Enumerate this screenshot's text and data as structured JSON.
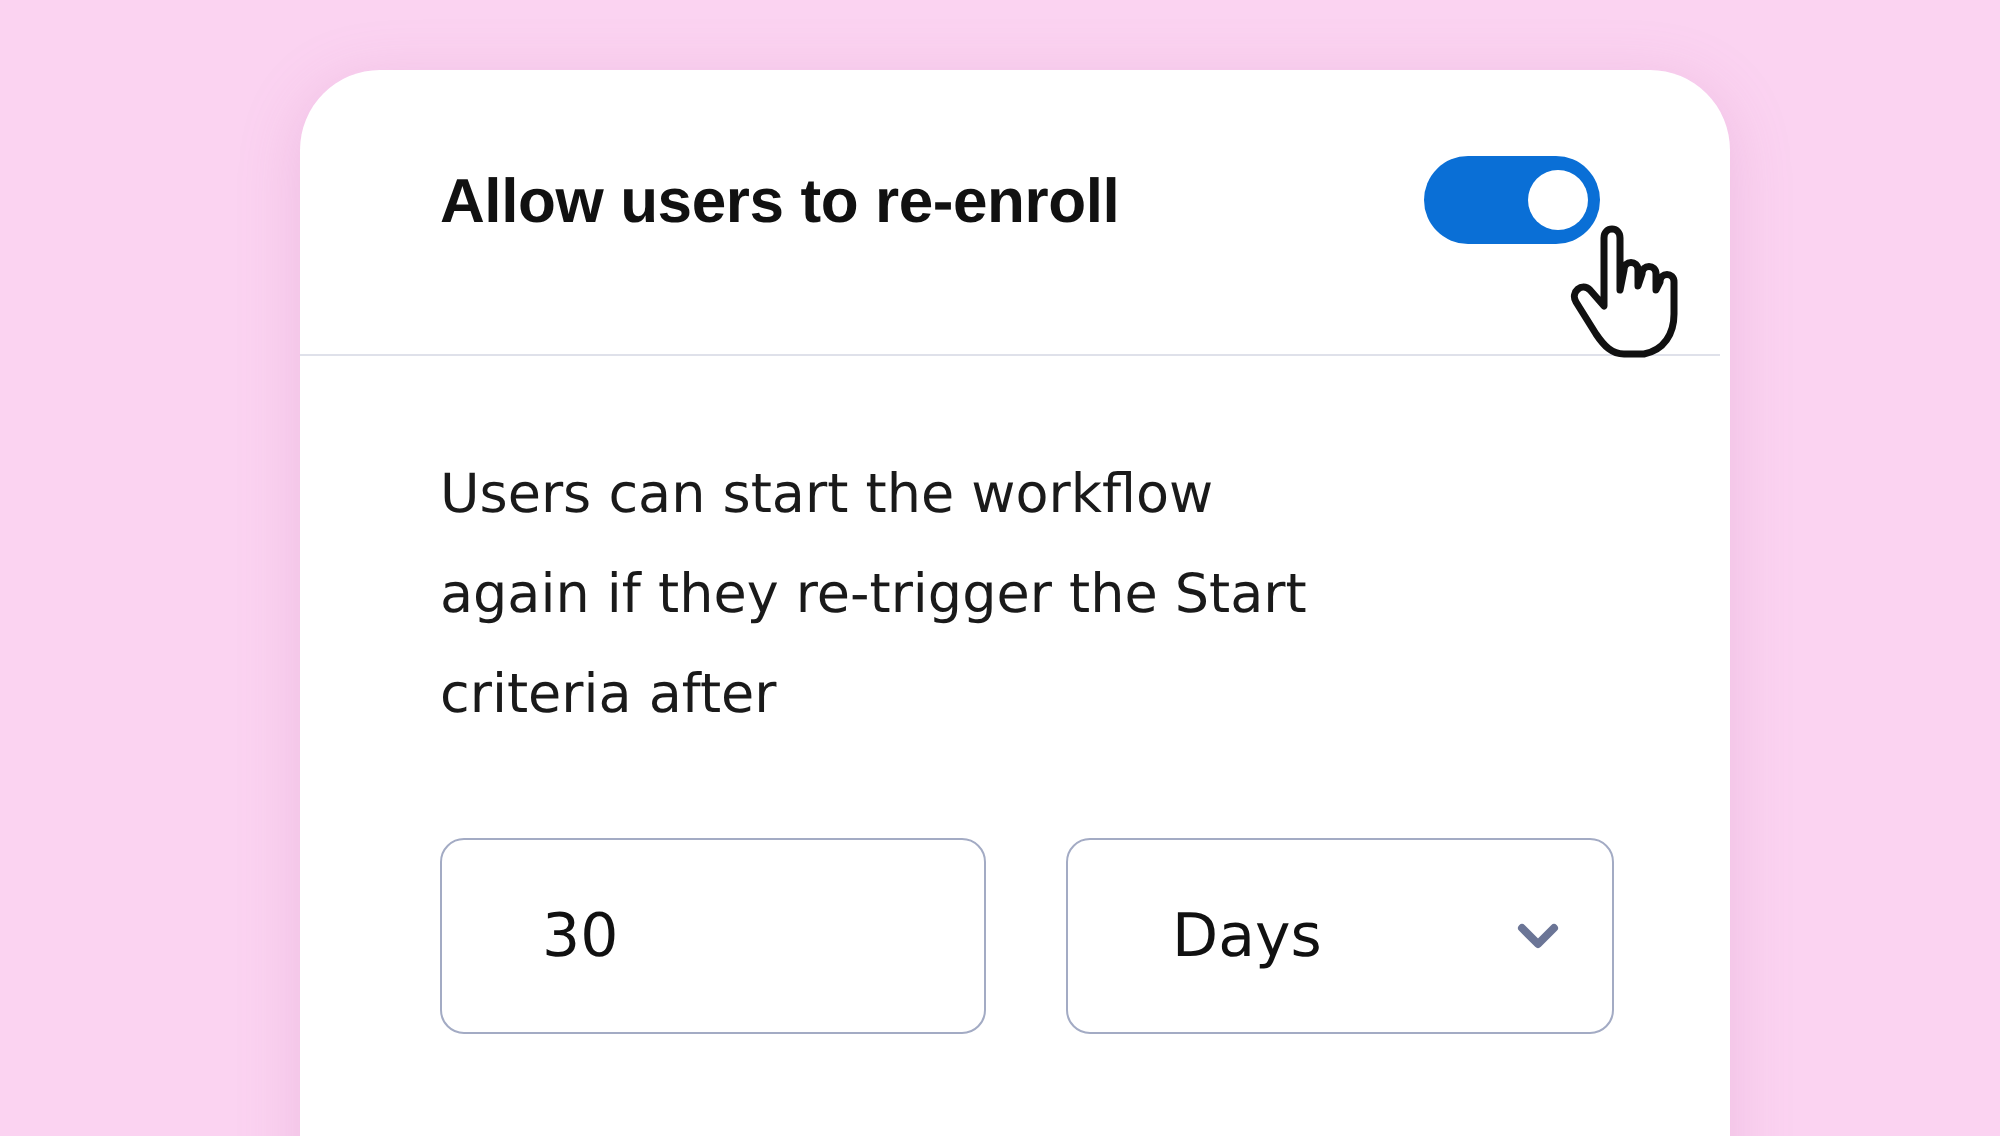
{
  "setting": {
    "title": "Allow users to re-enroll",
    "toggle": {
      "on": true
    }
  },
  "description": "Users can start the workflow again if they re-trigger the Start criteria after",
  "number_field": {
    "value": "30"
  },
  "unit_select": {
    "value": "Days"
  }
}
